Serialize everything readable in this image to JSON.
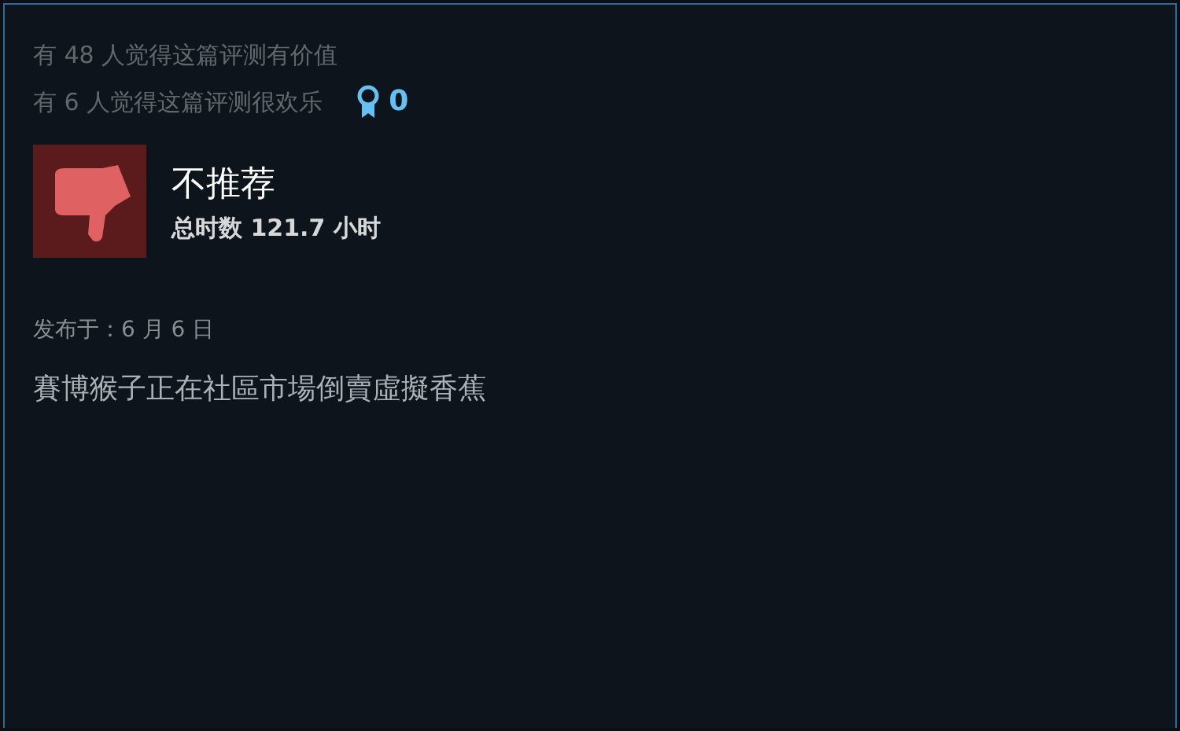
{
  "helpful": "有 48 人觉得这篇评测有价值",
  "funny": "有 6 人觉得这篇评测很欢乐",
  "awards": "0",
  "review": {
    "verdict": "不推荐",
    "recommended": false,
    "hours": "总时数 121.7 小时",
    "posted": "发布于：6 月 6 日",
    "text": "賽博猴子正在社區市場倒賣虛擬香蕉"
  }
}
